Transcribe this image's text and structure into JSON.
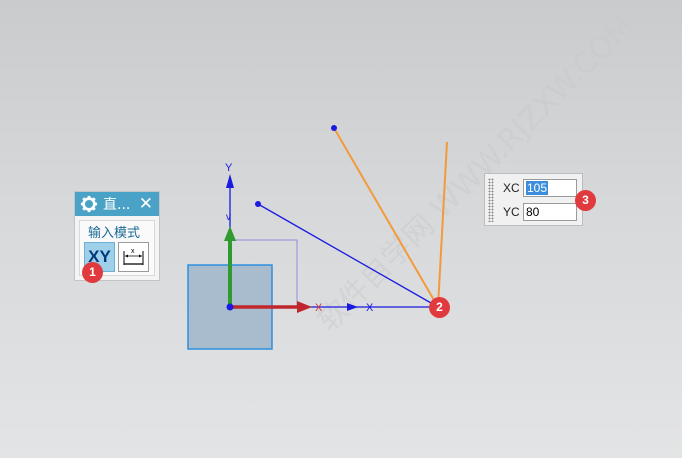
{
  "dialog": {
    "title": "直...",
    "close_glyph": "✕",
    "icon": "gear-icon",
    "input_mode_label": "输入模式",
    "xy_button_label": "XY",
    "dimension_button_icon": "dimension-icon"
  },
  "coord_input": {
    "xc_label": "XC",
    "xc_value": "105",
    "yc_label": "YC",
    "yc_value": "80"
  },
  "canvas": {
    "axis_y_label": "Y",
    "axis_mark": "X",
    "watermark": "软件自学网 WWW.RJZXW.COM"
  },
  "badges": [
    "1",
    "2",
    "3"
  ],
  "colors": {
    "title_bar": "#4aa2c6",
    "axis_blue": "#1a1ae0",
    "axis_green": "#2f9a2f",
    "axis_red": "#c0272d",
    "preview_orange": "#f39a3a",
    "badge_red": "#e03a3e",
    "square_fill": "#a9bccd"
  }
}
